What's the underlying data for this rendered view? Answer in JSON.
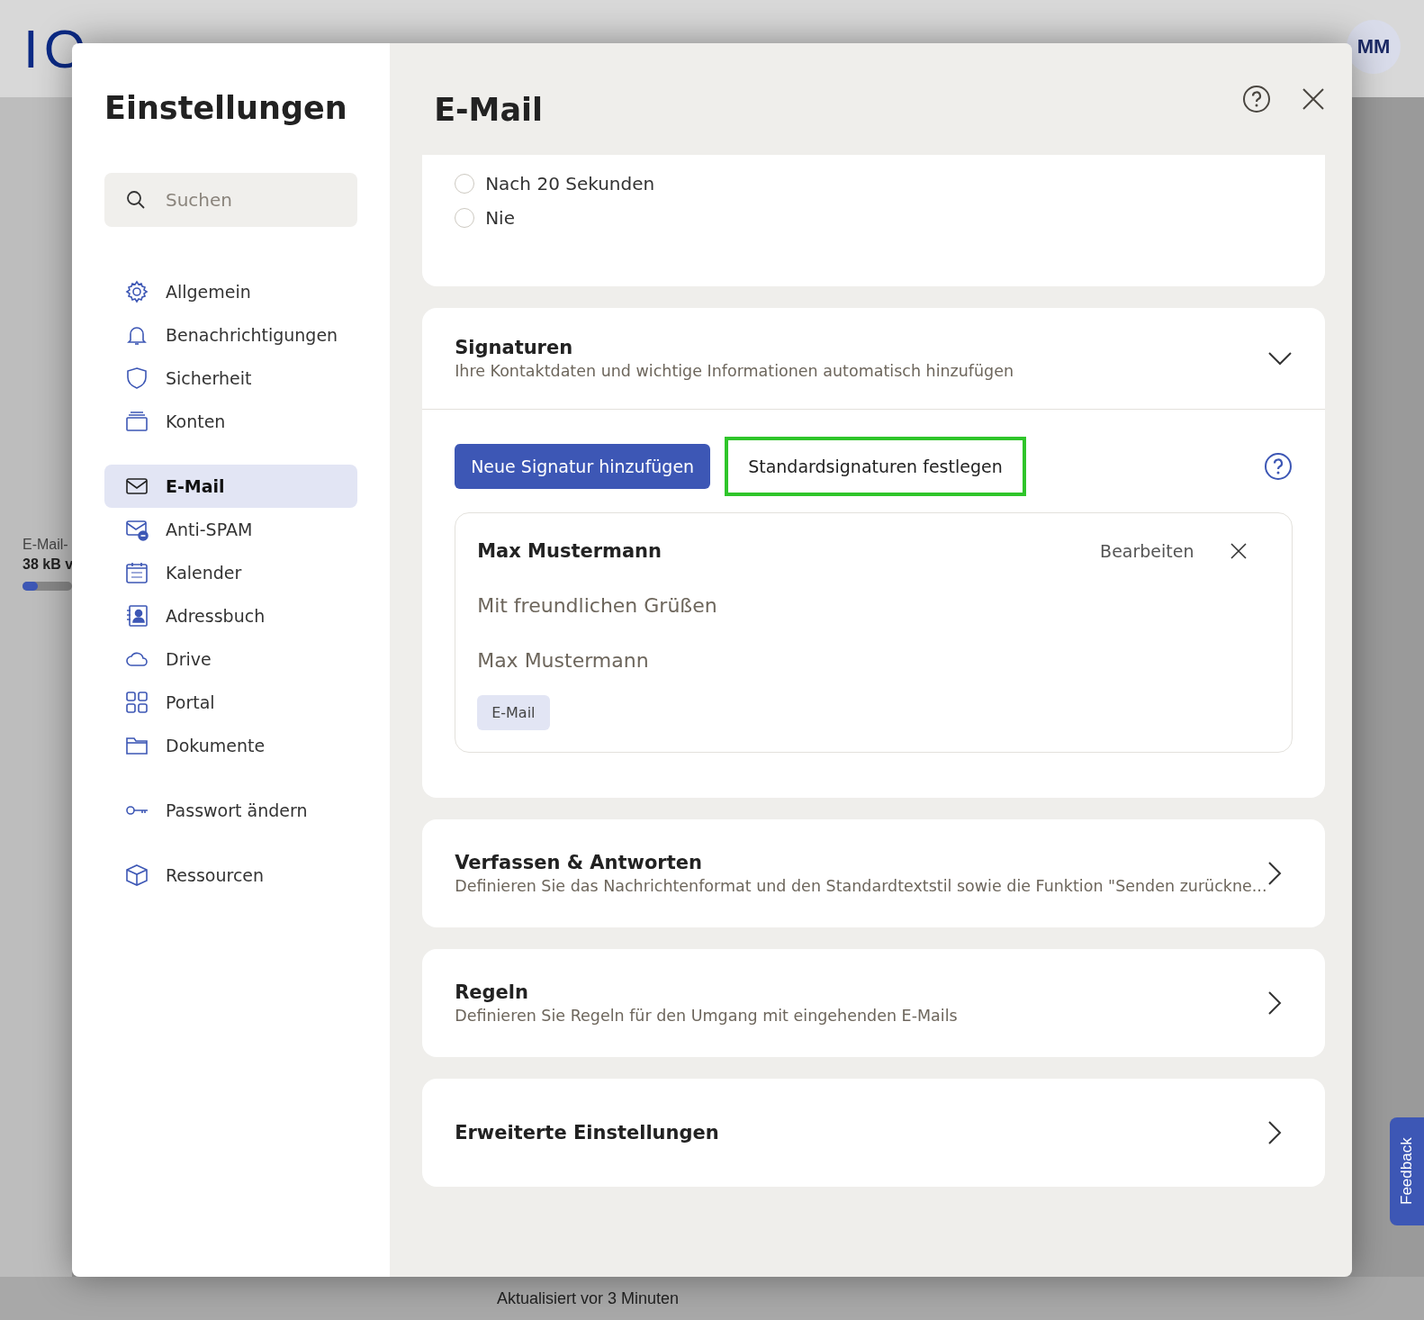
{
  "background": {
    "logo": "IO",
    "avatar": "MM",
    "storage_label": "E-Mail-",
    "storage_value": "38 kB v",
    "storage": {
      "level": 0.3
    },
    "status": "Aktualisiert vor 3 Minuten",
    "feedback": "Feedback"
  },
  "settings": {
    "title": "Einstellungen",
    "search": {
      "placeholder": "Suchen"
    },
    "nav_groups": [
      [
        {
          "label": "Allgemein",
          "selected": false
        },
        {
          "label": "Benachrichtigungen",
          "selected": false
        },
        {
          "label": "Sicherheit",
          "selected": false
        },
        {
          "label": "Konten",
          "selected": false
        }
      ],
      [
        {
          "label": "E-Mail",
          "selected": true
        },
        {
          "label": "Anti-SPAM",
          "selected": false
        },
        {
          "label": "Kalender",
          "selected": false
        },
        {
          "label": "Adressbuch",
          "selected": false
        },
        {
          "label": "Drive",
          "selected": false
        },
        {
          "label": "Portal",
          "selected": false
        },
        {
          "label": "Dokumente",
          "selected": false
        }
      ],
      [
        {
          "label": "Passwort ändern",
          "selected": false
        }
      ],
      [
        {
          "label": "Ressourcen",
          "selected": false
        }
      ]
    ]
  },
  "panel": {
    "title": "E-Mail",
    "radios": [
      {
        "label": "Nach 20 Sekunden",
        "selected": false
      },
      {
        "label": "Nie",
        "selected": false
      }
    ],
    "signatures": {
      "title": "Signaturen",
      "description": "Ihre Kontaktdaten und wichtige Informationen automatisch hinzufügen",
      "expanded": true,
      "buttons": [
        {
          "label": "Neue Signatur hinzufügen",
          "kind": "primary",
          "highlighted": false
        },
        {
          "label": "Standardsignaturen festlegen",
          "kind": "plain",
          "highlighted": true
        }
      ],
      "items": [
        {
          "name": "Max Mustermann",
          "edit": "Bearbeiten",
          "lines": [
            "Mit freundlichen Grüßen",
            "Max Mustermann"
          ],
          "tags": [
            "E-Mail"
          ]
        }
      ]
    },
    "sections": [
      {
        "title": "Verfassen & Antworten",
        "description": "Definieren Sie das Nachrichtenformat und den Standardtextstil sowie die Funktion \"Senden zurückne..."
      },
      {
        "title": "Regeln",
        "description": "Definieren Sie Regeln für den Umgang mit eingehenden E-Mails"
      },
      {
        "title": "Erweiterte Einstellungen"
      }
    ]
  }
}
